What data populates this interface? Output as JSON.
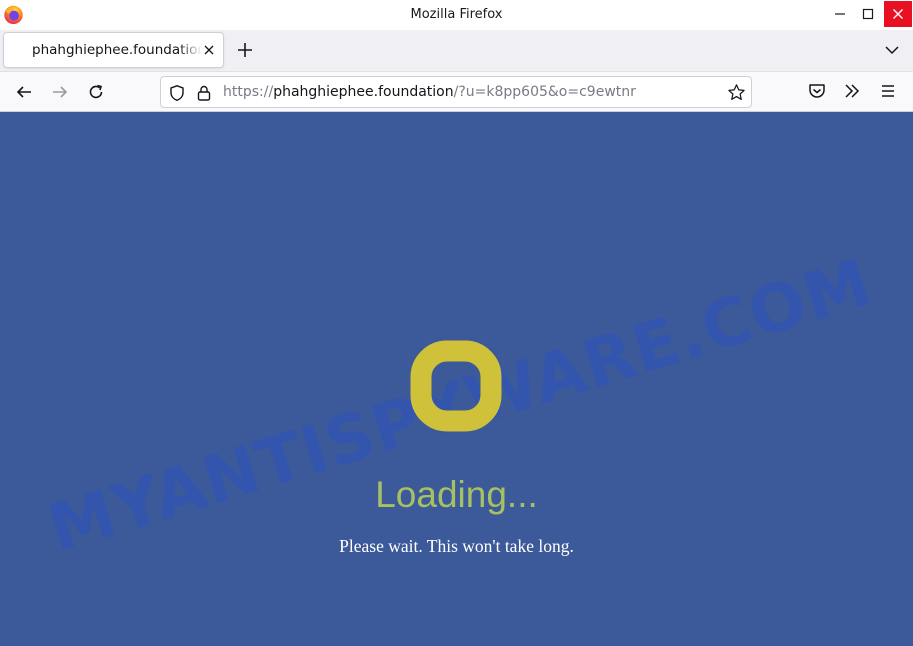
{
  "window": {
    "title": "Mozilla Firefox"
  },
  "tabs": [
    {
      "title": "phahghiephee.foundation",
      "active": true
    }
  ],
  "navbar": {
    "url_scheme": "https://",
    "url_host": "phahghiephee.foundation",
    "url_path": "/?u=k8pp605&o=c9ewtnr"
  },
  "icons": {
    "browser_logo": "firefox-logo-icon",
    "minimize": "minimize-icon",
    "maximize": "maximize-icon",
    "close": "close-icon",
    "tab_close": "tab-close-icon",
    "new_tab": "plus-icon",
    "list_tabs": "chevron-down-icon",
    "back": "arrow-left-icon",
    "forward": "arrow-right-icon",
    "reload": "reload-icon",
    "tracking_protection": "shield-icon",
    "secure": "lock-icon",
    "bookmark": "star-icon",
    "pocket": "pocket-icon",
    "more_tools": "double-chevron-icon",
    "app_menu": "hamburger-menu-icon"
  },
  "page": {
    "loading_text": "Loading...",
    "wait_text": "Please wait. This won't take long.",
    "watermark": "MYANTISPYWARE.COM"
  },
  "colors": {
    "page_background": "#3c5a99",
    "spinner": "#cfc23a",
    "loading_text": "#a7c063",
    "window_close": "#e81123"
  }
}
